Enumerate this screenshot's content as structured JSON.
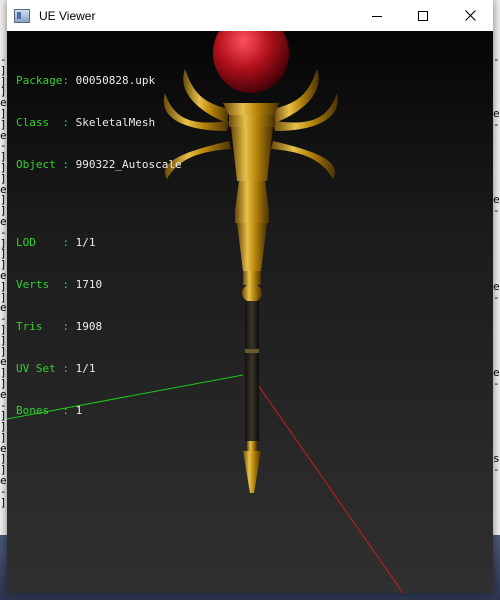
{
  "window": {
    "title": "UE Viewer",
    "controls": {
      "minimize": "—",
      "maximize": "☐",
      "close": "✕"
    }
  },
  "info": {
    "package_label": "Package: ",
    "package_value": "00050828.upk",
    "class_label": "Class  : ",
    "class_value": "SkeletalMesh",
    "object_label": "Object : ",
    "object_value": "990322_Autoscale",
    "lod_label": "LOD    : ",
    "lod_value": "1/1",
    "verts_label": "Verts  : ",
    "verts_value": "1710",
    "tris_label": "Tris   : ",
    "tris_value": "1908",
    "uvset_label": "UV Set : ",
    "uvset_value": "1/1",
    "bones_label": "Bones  : ",
    "bones_value": "1"
  },
  "colors": {
    "label_green": "#2fd32f",
    "value_white": "#ececec",
    "axis_green": "#1ec81e",
    "axis_red": "#c81e1e",
    "gold": "#c89a1e",
    "gem_red": "#b0101a"
  },
  "background_console": {
    "left_glyphs": "-\n]\n]\n]\ne\n]\n]\ne\n-\n]\n]\n]\ne\n]\n]\ne\n-\n]\n]\n]\ne\n]\n]\ne\n-\n]\n]\n]\ne\n]\n]\ne\n-\n]\n]\n]\ne\n]\n]\ne\n-\n]",
    "right_glyphs": "-\n\n\n\n\ne\n-\n\n\n\n\n\n\ne\n-\n\n\n\n\n\n\ne\n-\n\n\n\n\n\n\ne\n-\n\n\n\n\n\n\ns\n-"
  }
}
